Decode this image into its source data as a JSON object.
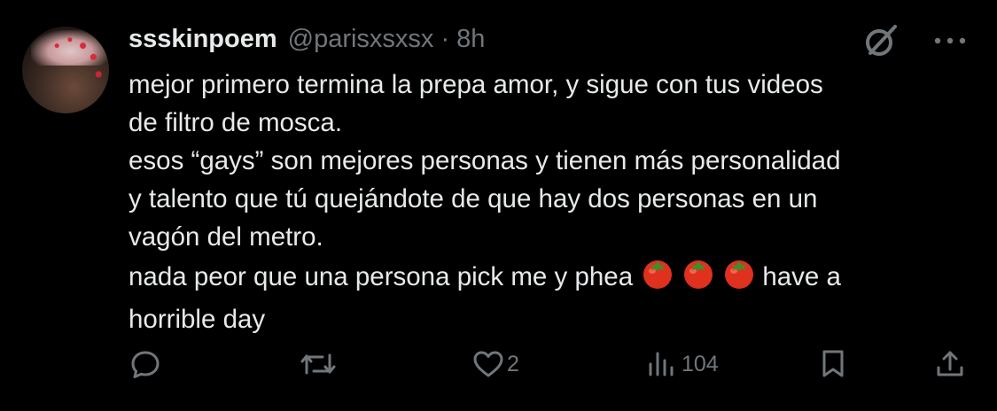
{
  "tweet": {
    "display_name": "ssskinpoem",
    "handle": "@parisxsxsx",
    "separator": "·",
    "time": "8h",
    "avatar_icon": "profile-photo",
    "lines": [
      "mejor primero termina la prepa amor, y sigue con tus videos",
      "de filtro de mosca.",
      "esos “gays” son mejores personas y tienen más personalidad",
      "y talento que tú quejándote de que hay dos personas en un",
      "vagón del metro.",
      "nada peor que una persona pick me y phea",
      "have a",
      "horrible day"
    ],
    "emoji_name": "tomato",
    "emoji_count": 3,
    "grok_icon": "grok-icon",
    "more_icon": "more-icon"
  },
  "actions": {
    "reply_icon": "reply-icon",
    "reply_count": "",
    "retweet_icon": "retweet-icon",
    "retweet_count": "",
    "like_icon": "heart-icon",
    "like_count": "2",
    "views_icon": "views-icon",
    "views_count": "104",
    "bookmark_icon": "bookmark-icon",
    "share_icon": "share-icon"
  },
  "colors": {
    "background": "#000000",
    "text": "#e7e9ea",
    "secondary": "#71767b",
    "tomato": "#e0301e"
  }
}
